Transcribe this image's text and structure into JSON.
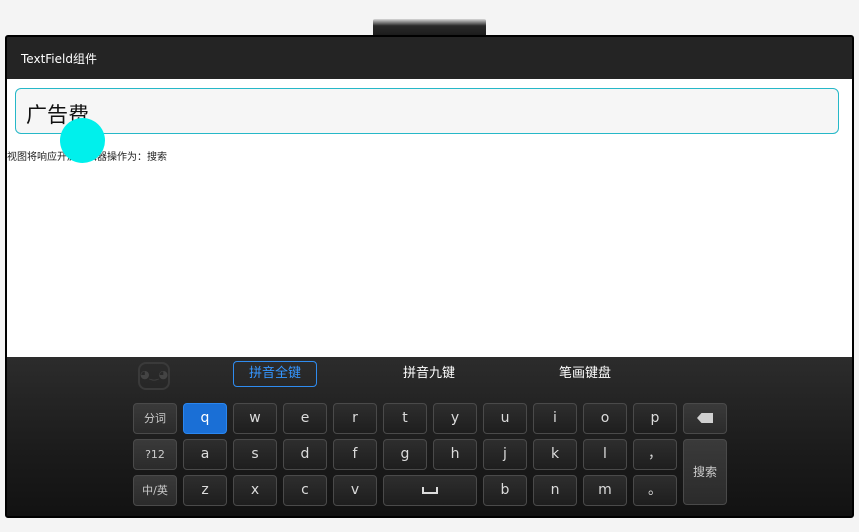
{
  "app": {
    "title": "TextField组件"
  },
  "textfield": {
    "value": "广告费"
  },
  "status": {
    "text": "视图将响应开启编辑器操作为：搜索"
  },
  "keyboard": {
    "modes": [
      {
        "label": "拼音全键",
        "active": true
      },
      {
        "label": "拼音九键",
        "active": false
      },
      {
        "label": "笔画键盘",
        "active": false
      }
    ],
    "rows": [
      [
        "分词",
        "q",
        "w",
        "e",
        "r",
        "t",
        "y",
        "u",
        "i",
        "o",
        "p",
        "backspace"
      ],
      [
        "?12",
        "a",
        "s",
        "d",
        "f",
        "g",
        "h",
        "j",
        "k",
        "l",
        "，"
      ],
      [
        "中/英",
        "z",
        "x",
        "c",
        "v",
        "space",
        "b",
        "n",
        "m",
        "。"
      ]
    ],
    "search_label": "搜索",
    "colors": {
      "accent": "#2f8cf0",
      "active_key": "#1a6fd6",
      "textfield_border": "#26b8c8",
      "touch_dot": "#00f0ec"
    }
  }
}
